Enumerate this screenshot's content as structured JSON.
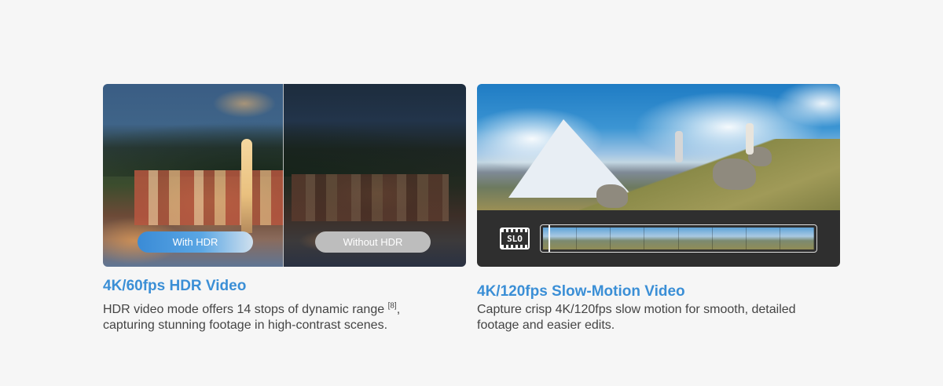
{
  "hdr_card": {
    "label_with": "With HDR",
    "label_without": "Without HDR",
    "title": "4K/60fps HDR Video",
    "description_before": "HDR video mode offers 14 stops of dynamic range ",
    "footnote": "[8]",
    "description_after": ", capturing stunning footage in high-contrast scenes.",
    "pill_with_color": "#4a9ae0",
    "pill_without_color": "#bdbdbd"
  },
  "slo_card": {
    "icon_text": "SLO",
    "title": "4K/120fps Slow-Motion Video",
    "description": "Capture crisp 4K/120fps slow motion for smooth, detailed footage and easier edits."
  },
  "colors": {
    "accent": "#3b8fd6",
    "body_text": "#444444",
    "background": "#f6f6f6"
  }
}
